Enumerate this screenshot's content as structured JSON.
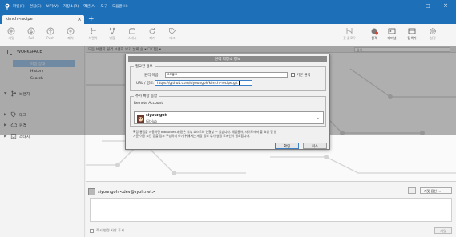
{
  "window": {
    "menu": [
      "파일(F)",
      "편집(E)",
      "보기(V)",
      "저장소(R)",
      "액션(A)",
      "도구",
      "도움말(H)"
    ],
    "controls": {
      "minimize": "–",
      "maximize": "□",
      "close": "×"
    }
  },
  "tabs": [
    {
      "label": "kimchi-recipe",
      "close": "×"
    }
  ],
  "tab_add": "+",
  "toolbar": {
    "left": [
      {
        "icon": "commit-icon",
        "label": "커밋"
      },
      {
        "icon": "pull-icon",
        "label": "Pull"
      },
      {
        "icon": "push-icon",
        "label": "Push"
      },
      {
        "icon": "fetch-icon",
        "label": "패치"
      },
      {
        "icon": "branch-icon",
        "label": "브랜치"
      },
      {
        "icon": "merge-icon",
        "label": "병합"
      },
      {
        "icon": "stash-icon",
        "label": "스태시"
      },
      {
        "icon": "discard-icon",
        "label": "폐기"
      },
      {
        "icon": "tag-icon",
        "label": "태그"
      }
    ],
    "right": [
      {
        "icon": "git-flow-icon",
        "label": "깃 플로우"
      },
      {
        "icon": "remote-icon",
        "label": "원격"
      },
      {
        "icon": "terminal-icon",
        "label": "터미널"
      },
      {
        "icon": "explorer-icon",
        "label": "탐색기"
      },
      {
        "icon": "settings-icon",
        "label": "설정"
      }
    ]
  },
  "sidebar": {
    "workspace": "WORKSPACE",
    "items": [
      "파일 상태",
      "History",
      "Search"
    ],
    "branches_label": "브랜치",
    "branch": "master",
    "sections": [
      "태그",
      "원격",
      "스태시"
    ]
  },
  "main": {
    "filter_text": "모든 브랜치   원격 브랜치 보기   날짜 순 ▾   ☐ 다음 ▾",
    "search_placeholder": "검색"
  },
  "dialog": {
    "title": "원격 저장소 정보",
    "required_legend": "필요한 정보",
    "name_label": "원격 이름:",
    "name_value": "origin",
    "default_remote_label": "기본 원격",
    "default_remote_checked": false,
    "url_label": "URL / 경로:",
    "url_value": "https://github.com/siyoungoh/kimchi-recipe.git",
    "extended_legend": "추가 확장 통합",
    "account_label": "Remote Account",
    "account_name": "siyoungoh",
    "account_host": "GitHub",
    "note_line1": "확장 통합을 사용하면 Bitbucket 과 같은 외부 호스트와 연결할 수 있습니다. 예를들어, 사이트에서 풀 요청 및 웹",
    "note_line2": "기준 이용 조건 등을 링크 구성하기 하기 위해서는 계정 정보 추가 설정 도메인이 필요합니다.",
    "ok": "확인",
    "cancel": "취소"
  },
  "commit": {
    "author": "siyoungoh <dev@syoh.net>",
    "options_label": "커밋 옵션 ...",
    "push_option": "즉시 변경 사항 푸시",
    "commit_button": "커밋"
  }
}
